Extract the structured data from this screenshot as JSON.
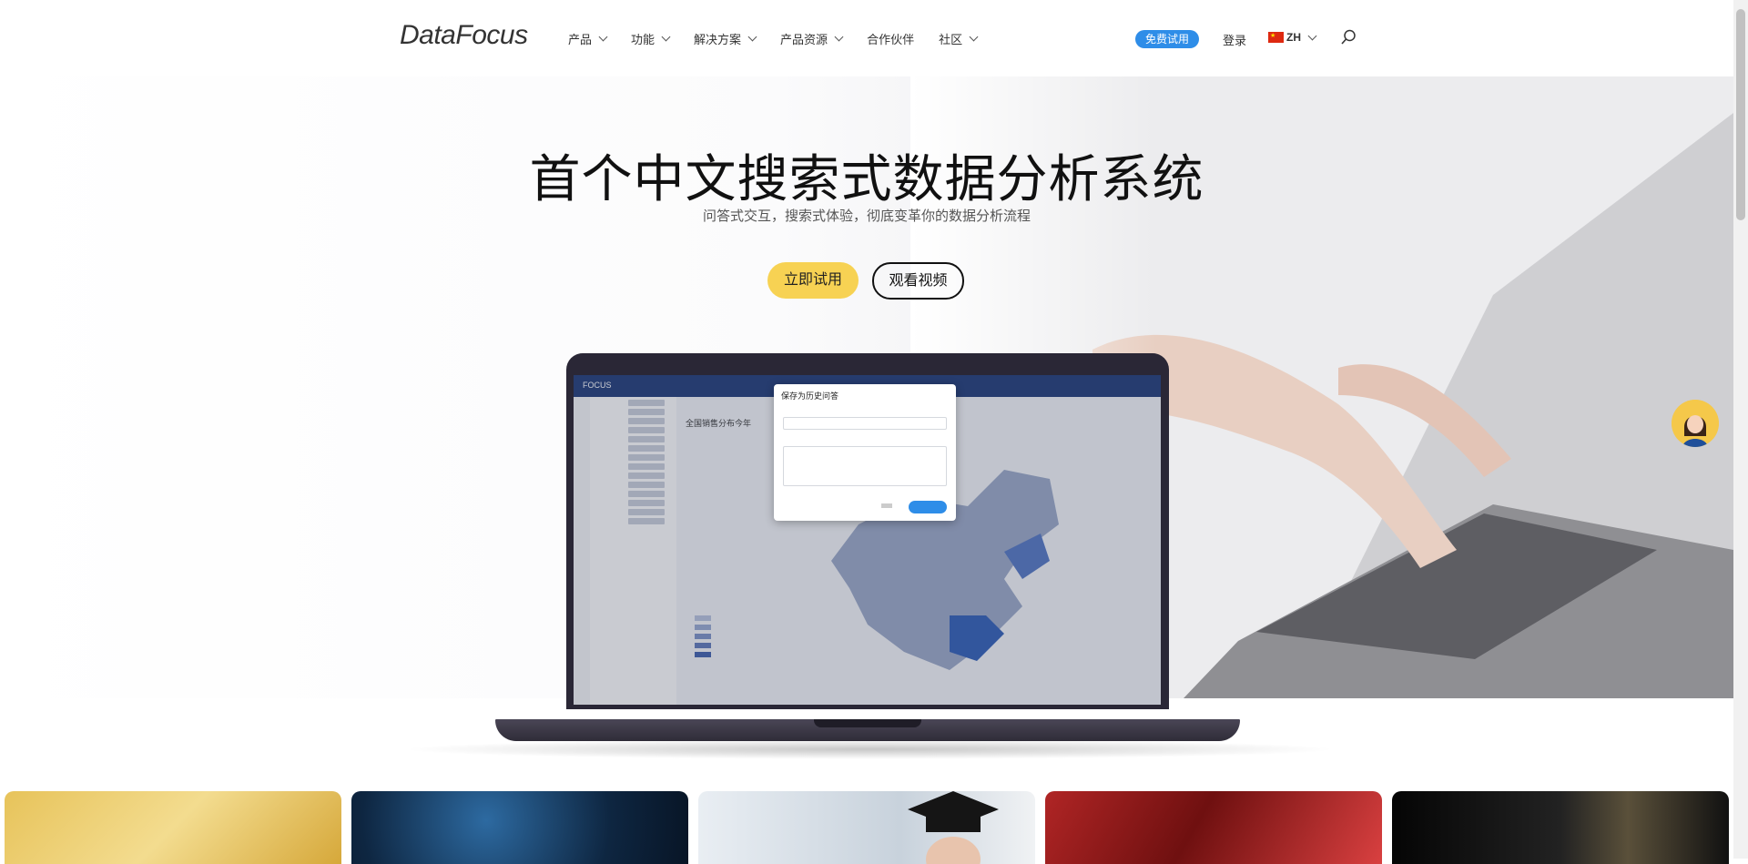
{
  "nav": {
    "logo": "DataFocus",
    "menu": [
      {
        "label": "产品",
        "has_dropdown": true
      },
      {
        "label": "功能",
        "has_dropdown": true
      },
      {
        "label": "解决方案",
        "has_dropdown": true
      },
      {
        "label": "产品资源",
        "has_dropdown": true
      },
      {
        "label": "合作伙伴",
        "has_dropdown": false
      },
      {
        "label": "社区",
        "has_dropdown": true
      }
    ],
    "trial_label": "免费试用",
    "login_label": "登录",
    "lang_label": "ZH",
    "search_icon": "search-icon"
  },
  "hero": {
    "headline": "首个中文搜索式数据分析系统",
    "subline": "问答式交互，搜索式体验，彻底变革你的数据分析流程",
    "try_label": "立即试用",
    "video_label": "观看视频"
  },
  "screen": {
    "brand": "FOCUS",
    "chart_title": "全国销售分布今年",
    "dialog_title": "保存为历史问答"
  },
  "colors": {
    "accent_blue": "#2e8de8",
    "cta_yellow": "#f7d253",
    "laptop_frame": "#2a2736"
  }
}
